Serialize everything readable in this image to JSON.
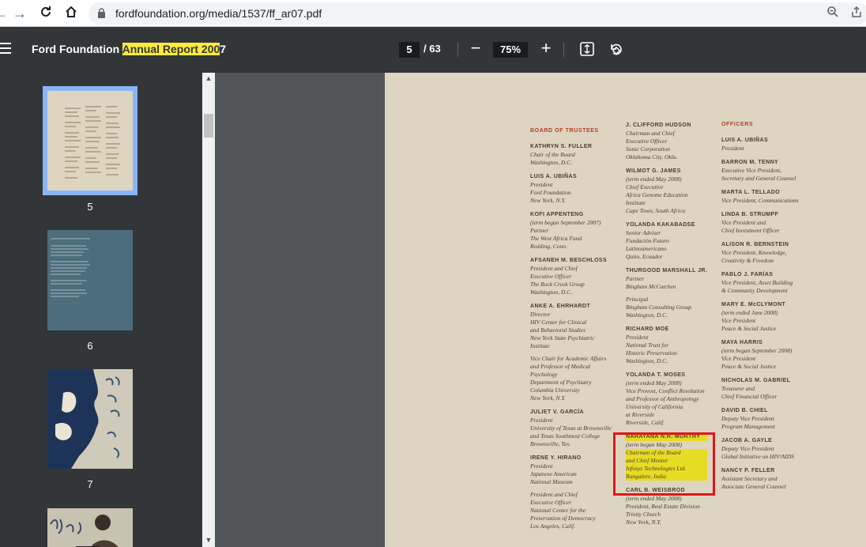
{
  "browser": {
    "url": "fordfoundation.org/media/1537/ff_ar07.pdf"
  },
  "toolbar": {
    "title_prefix": "Ford Foundation ",
    "title_highlight": "Annual Report 200",
    "title_suffix": "7",
    "current_page": "5",
    "total_pages": "/ 63",
    "zoom": "75%"
  },
  "sidebar": {
    "thumbnails": [
      {
        "label": "5"
      },
      {
        "label": "6"
      },
      {
        "label": "7"
      }
    ]
  },
  "document": {
    "board_heading": "BOARD OF TRUSTEES",
    "officers_heading": "OFFICERS",
    "col1": [
      {
        "name": "KATHRYN S. FULLER",
        "lines": [
          "Chair of the Board",
          "Washington, D.C."
        ]
      },
      {
        "name": "LUIS A. UBIÑAS",
        "lines": [
          "President",
          "Ford Foundation",
          "New York, N.Y."
        ]
      },
      {
        "name": "KOFI APPENTENG",
        "lines": [
          "(term began September 2007)",
          "Partner",
          "The West Africa Fund",
          "Redding, Conn."
        ]
      },
      {
        "name": "AFSANEH M. BESCHLOSS",
        "lines": [
          "President and Chief",
          "Executive Officer",
          "The Rock Creek Group",
          "Washington, D.C."
        ]
      },
      {
        "name": "ANKE A. EHRHARDT",
        "lines": [
          "Director",
          "HIV Center for Clinical",
          "and Behavioral Studies",
          "New York State Psychiatric",
          "Institute",
          "",
          "Vice Chair for Academic Affairs",
          "and Professor of Medical",
          "Psychology",
          "Department of Psychiatry",
          "Columbia University",
          "New York, N.Y."
        ]
      },
      {
        "name": "JULIET V. GARCÍA",
        "lines": [
          "President",
          "University of Texas at Brownsville",
          "and Texas Southmost College",
          "Brownsville, Tex."
        ]
      },
      {
        "name": "IRENE Y. HIRANO",
        "lines": [
          "President",
          "Japanese American",
          "National Museum",
          "",
          "President and Chief",
          "Executive Officer",
          "National Center for the",
          "Preservation of Democracy",
          "Los Angeles, Calif."
        ]
      }
    ],
    "col2": [
      {
        "name": "J. CLIFFORD HUDSON",
        "lines": [
          "Chairman and Chief",
          "Executive Officer",
          "Sonic Corporation",
          "Oklahoma City, Okla."
        ]
      },
      {
        "name": "WILMOT G. JAMES",
        "lines": [
          "(term ended May 2008)",
          "Chief Executive",
          "Africa Genome Education",
          "Institute",
          "Cape Town, South Africa"
        ]
      },
      {
        "name": "YOLANDA KAKABADSE",
        "lines": [
          "Senior Adviser",
          "Fundación Futuro",
          "Latinoamericano",
          "Quito, Ecuador"
        ]
      },
      {
        "name": "THURGOOD MARSHALL JR.",
        "lines": [
          "Partner",
          "Bingham McCutchen",
          "",
          "Principal",
          "Bingham Consulting Group",
          "Washington, D.C."
        ]
      },
      {
        "name": "RICHARD MOE",
        "lines": [
          "President",
          "National Trust for",
          "Historic Preservation",
          "Washington, D.C."
        ]
      },
      {
        "name": "YOLANDA T. MOSES",
        "lines": [
          "(term ended May 2008)",
          "Vice Provost, Conflict Resolution",
          "and Professor of Anthropology",
          "University of California",
          "at Riverside",
          "Riverside, Calif."
        ]
      },
      {
        "name": "NARAYANA N.R. MURTHY",
        "lines": [
          "(term began May 2008)",
          "Chairman of the Board",
          "and Chief Mentor",
          "Infosys Technologies Ltd.",
          "Bangalore, India"
        ],
        "highlighted": true
      },
      {
        "name": "CARL B. WEISBROD",
        "lines": [
          "(term ended May 2008)",
          "President, Real Estate Division",
          "Trinity Church",
          "New York, N.Y."
        ]
      }
    ],
    "col3": [
      {
        "name": "LUIS A. UBIÑAS",
        "lines": [
          "President"
        ]
      },
      {
        "name": "BARRON M. TENNY",
        "lines": [
          "Executive Vice President,",
          "Secretary and General Counsel"
        ]
      },
      {
        "name": "MARTA L. TELLADO",
        "lines": [
          "Vice President, Communications"
        ]
      },
      {
        "name": "LINDA B. STRUMPF",
        "lines": [
          "Vice President and",
          "Chief Investment Officer"
        ]
      },
      {
        "name": "ALISON R. BERNSTEIN",
        "lines": [
          "Vice President, Knowledge,",
          "Creativity & Freedom"
        ]
      },
      {
        "name": "PABLO J. FARÍAS",
        "lines": [
          "Vice President, Asset Building",
          "& Community Development"
        ]
      },
      {
        "name": "MARY E. McCLYMONT",
        "lines": [
          "(term ended June 2008)",
          "Vice President",
          "Peace & Social Justice"
        ]
      },
      {
        "name": "MAYA HARRIS",
        "lines": [
          "(term began September 2008)",
          "Vice President",
          "Peace & Social Justice"
        ]
      },
      {
        "name": "NICHOLAS M. GABRIEL",
        "lines": [
          "Treasurer and",
          "Chief Financial Officer"
        ]
      },
      {
        "name": "DAVID B. CHIEL",
        "lines": [
          "Deputy Vice President",
          "Program Management"
        ]
      },
      {
        "name": "JACOB A. GAYLE",
        "lines": [
          "Deputy Vice President",
          "Global Initiative on HIV/AIDS"
        ]
      },
      {
        "name": "NANCY P. FELLER",
        "lines": [
          "Assistant Secretary and",
          "Associate General Counsel"
        ]
      }
    ]
  }
}
